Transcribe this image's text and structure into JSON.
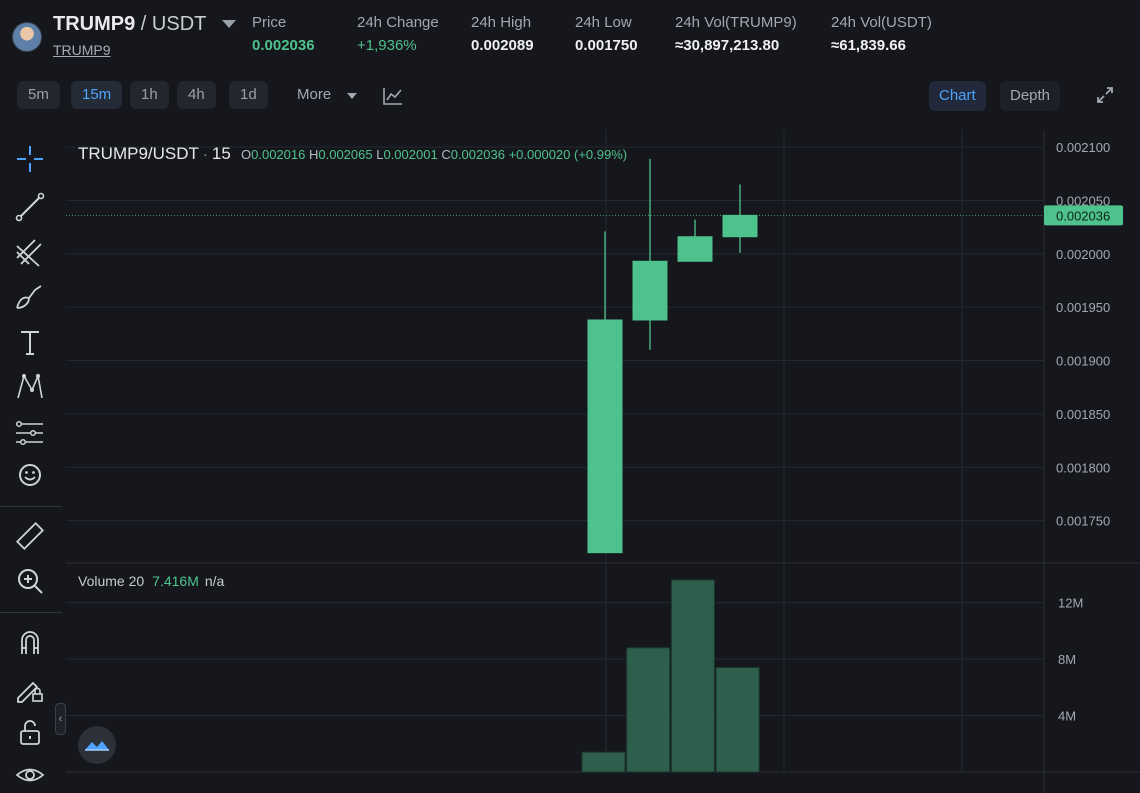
{
  "header": {
    "pair_base": "TRUMP9",
    "pair_sep": " / ",
    "pair_quote": "USDT",
    "sublink": "TRUMP9",
    "stats": [
      {
        "label": "Price",
        "value": "0.002036",
        "style": "green"
      },
      {
        "label": "24h Change",
        "value": "+1,936%",
        "style": "green-n"
      },
      {
        "label": "24h High",
        "value": "0.002089",
        "style": ""
      },
      {
        "label": "24h Low",
        "value": "0.001750",
        "style": ""
      },
      {
        "label": "24h Vol(TRUMP9)",
        "value": "≈30,897,213.80",
        "style": ""
      },
      {
        "label": "24h Vol(USDT)",
        "value": "≈61,839.66",
        "style": ""
      }
    ]
  },
  "toolbar": {
    "timeframes": [
      "5m",
      "15m",
      "1h",
      "4h",
      "1d"
    ],
    "active_timeframe": "15m",
    "more_label": "More",
    "views": [
      "Chart",
      "Depth"
    ],
    "active_view": "Chart"
  },
  "left_tools": [
    "crosshair-icon",
    "trend-line-icon",
    "fib-tool-icon",
    "brush-icon",
    "text-tool-icon",
    "pattern-icon",
    "prediction-icon",
    "emoji-icon",
    "ruler-icon",
    "zoom-in-icon",
    "magnet-icon",
    "lock-drawing-icon",
    "unlock-icon",
    "eye-icon"
  ],
  "legend": {
    "symbol": "TRUMP9/USDT",
    "interval": "15",
    "o_label": "O",
    "o": "0.002016",
    "h_label": "H",
    "h": "0.002065",
    "l_label": "L",
    "l": "0.002001",
    "c_label": "C",
    "c": "0.002036",
    "change": "+0.000020 (+0.99%)"
  },
  "volume_legend": {
    "label": "Volume 20",
    "value": "7.416M",
    "na": "n/a"
  },
  "colors": {
    "up": "#4ec28d",
    "volume": "#2e5e4c",
    "grid": "#252830",
    "axis_text": "#a3a8b0",
    "price_tag": "#4ec28d"
  },
  "chart_data": {
    "type": "candlestick",
    "price_axis": {
      "ticks": [
        0.0021,
        0.00205,
        0.002,
        0.00195,
        0.0019,
        0.00185,
        0.0018,
        0.00175
      ],
      "tick_labels": [
        "0.002100",
        "0.002050",
        "0.002000",
        "0.001950",
        "0.001900",
        "0.001850",
        "0.001800",
        "0.001750"
      ],
      "range": [
        0.001715,
        0.002116
      ]
    },
    "current_price": {
      "value": 0.002036,
      "label": "0.002036"
    },
    "candles": [
      {
        "open": 0.00172,
        "high": 0.002021,
        "low": 0.00172,
        "close": 0.001938
      },
      {
        "open": 0.001938,
        "high": 0.002089,
        "low": 0.00191,
        "close": 0.001993
      },
      {
        "open": 0.001993,
        "high": 0.002032,
        "low": 0.001993,
        "close": 0.002016
      },
      {
        "open": 0.002016,
        "high": 0.002065,
        "low": 0.002001,
        "close": 0.002036
      }
    ],
    "volume_axis": {
      "ticks": [
        12,
        8,
        4
      ],
      "tick_labels": [
        "12M",
        "8M",
        "4M"
      ],
      "unit": "M",
      "range": [
        0,
        13.6
      ]
    },
    "volumes_m": [
      1.4,
      8.8,
      13.6,
      7.4
    ]
  }
}
